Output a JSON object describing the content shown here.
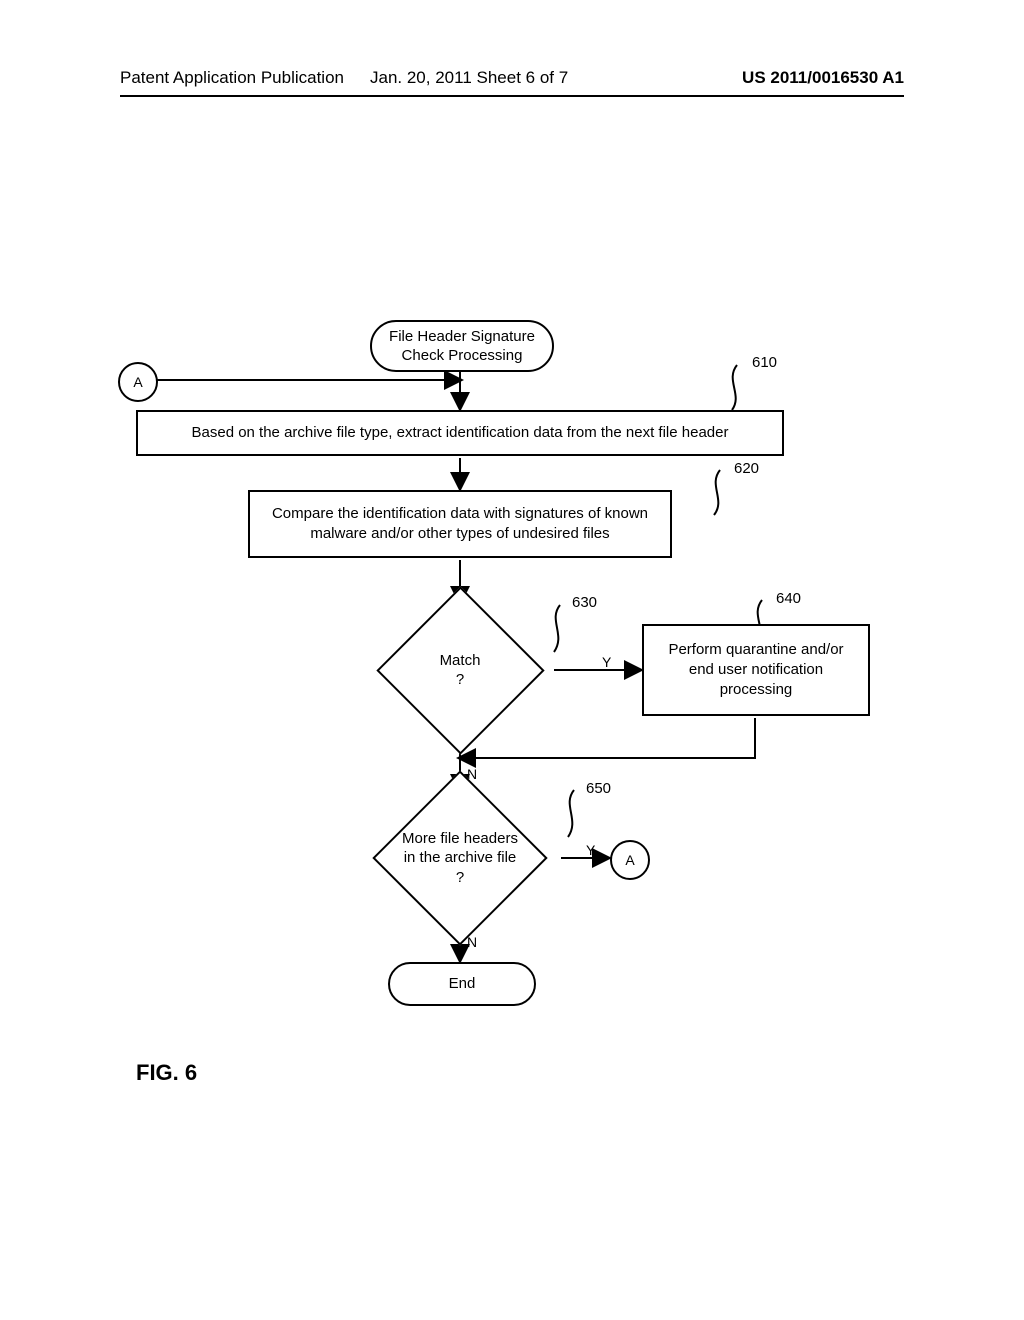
{
  "header": {
    "left": "Patent Application Publication",
    "center": "Jan. 20, 2011  Sheet 6 of 7",
    "right": "US 2011/0016530 A1"
  },
  "figure": {
    "caption": "FIG. 6"
  },
  "nodes": {
    "start": "File Header Signature\nCheck Processing",
    "connectorA1": "A",
    "step610": "Based on the archive file type, extract identification data from the next file header",
    "step620": "Compare the identification data with signatures of known\nmalware and/or other types of undesired files",
    "dec630": "Match\n?",
    "step640": "Perform quarantine and/or\nend user notification\nprocessing",
    "dec650": "More file headers\nin the archive file\n?",
    "connectorA2": "A",
    "end": "End"
  },
  "refs": {
    "r610": "610",
    "r620": "620",
    "r630": "630",
    "r640": "640",
    "r650": "650"
  },
  "labels": {
    "yes": "Y",
    "no": "N"
  },
  "chart_data": {
    "type": "flowchart",
    "title": "File Header Signature Check Processing",
    "nodes": [
      {
        "id": "A_in",
        "type": "connector",
        "label": "A"
      },
      {
        "id": "start",
        "type": "terminator",
        "label": "File Header Signature Check Processing"
      },
      {
        "id": "610",
        "type": "process",
        "label": "Based on the archive file type, extract identification data from the next file header"
      },
      {
        "id": "620",
        "type": "process",
        "label": "Compare the identification data with signatures of known malware and/or other types of undesired files"
      },
      {
        "id": "630",
        "type": "decision",
        "label": "Match ?"
      },
      {
        "id": "640",
        "type": "process",
        "label": "Perform quarantine and/or end user notification processing"
      },
      {
        "id": "650",
        "type": "decision",
        "label": "More file headers in the archive file ?"
      },
      {
        "id": "A_out",
        "type": "connector",
        "label": "A"
      },
      {
        "id": "end",
        "type": "terminator",
        "label": "End"
      }
    ],
    "edges": [
      {
        "from": "A_in",
        "to": "610"
      },
      {
        "from": "start",
        "to": "610"
      },
      {
        "from": "610",
        "to": "620"
      },
      {
        "from": "620",
        "to": "630"
      },
      {
        "from": "630",
        "to": "640",
        "label": "Y"
      },
      {
        "from": "630",
        "to": "650",
        "label": "N"
      },
      {
        "from": "640",
        "to": "650"
      },
      {
        "from": "650",
        "to": "A_out",
        "label": "Y"
      },
      {
        "from": "650",
        "to": "end",
        "label": "N"
      }
    ]
  }
}
